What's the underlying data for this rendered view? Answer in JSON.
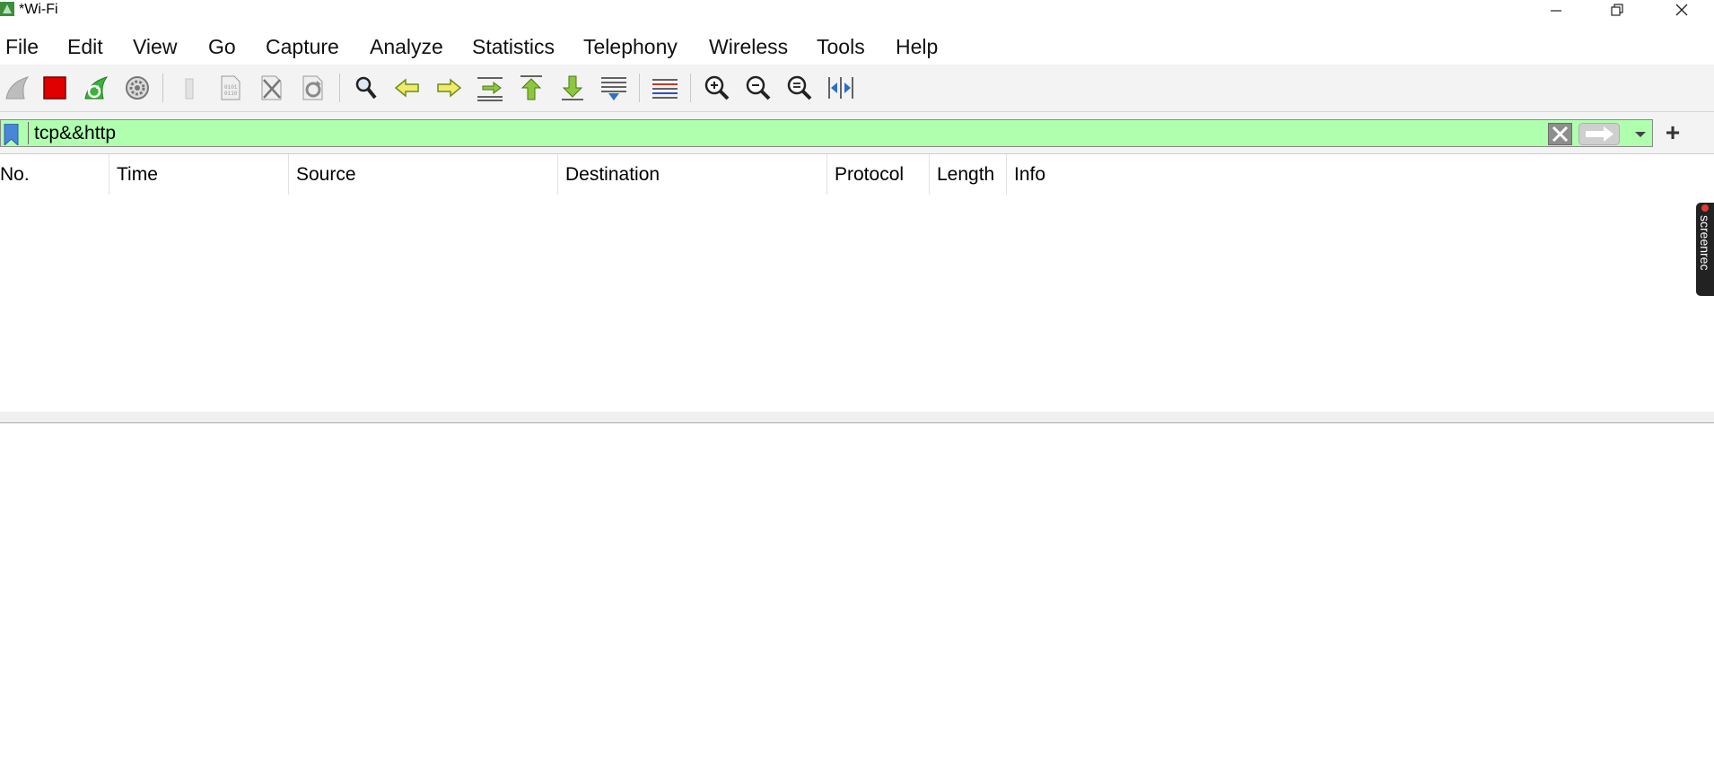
{
  "window": {
    "title": "*Wi-Fi"
  },
  "menu": {
    "items": [
      "File",
      "Edit",
      "View",
      "Go",
      "Capture",
      "Analyze",
      "Statistics",
      "Telephony",
      "Wireless",
      "Tools",
      "Help"
    ]
  },
  "toolbar": {
    "icons": [
      "start-capture-icon",
      "stop-capture-icon",
      "restart-capture-icon",
      "capture-options-icon",
      "open-file-icon",
      "save-file-icon",
      "close-file-icon",
      "reload-file-icon",
      "find-packet-icon",
      "go-back-icon",
      "go-forward-icon",
      "go-to-packet-icon",
      "first-packet-icon",
      "last-packet-icon",
      "autoscroll-icon",
      "colorize-icon",
      "zoom-in-icon",
      "zoom-out-icon",
      "normal-size-icon",
      "resize-columns-icon"
    ]
  },
  "filter": {
    "value": "tcp&&http",
    "add_label": "+"
  },
  "packet_list": {
    "columns": [
      "No.",
      "Time",
      "Source",
      "Destination",
      "Protocol",
      "Length",
      "Info"
    ],
    "scroll_left": "<",
    "scroll_right": ">"
  },
  "overlay": {
    "screenrec_label": "screenrec"
  },
  "colors": {
    "filter_valid_bg": "#afffaf",
    "toolbar_bg": "#f3f3f3",
    "stop_red": "#e00000",
    "shark_green": "#3bb33b"
  }
}
